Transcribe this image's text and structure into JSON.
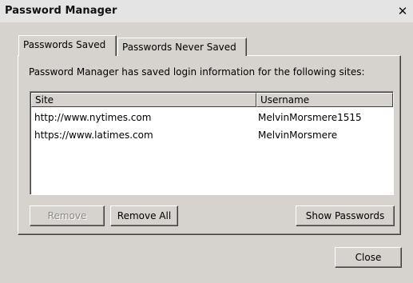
{
  "window": {
    "title": "Password Manager",
    "close_glyph": "✕"
  },
  "tabs": [
    {
      "label": "Passwords Saved",
      "active": true
    },
    {
      "label": "Passwords Never Saved",
      "active": false
    }
  ],
  "panel": {
    "description": "Password Manager has saved login information for the following sites:",
    "columns": {
      "site": "Site",
      "username": "Username"
    },
    "rows": [
      {
        "site": "http://www.nytimes.com",
        "username": "MelvinMorsmere1515"
      },
      {
        "site": "https://www.latimes.com",
        "username": "MelvinMorsmere"
      }
    ]
  },
  "buttons": {
    "remove": "Remove",
    "remove_all": "Remove All",
    "show_passwords": "Show Passwords",
    "close": "Close"
  }
}
